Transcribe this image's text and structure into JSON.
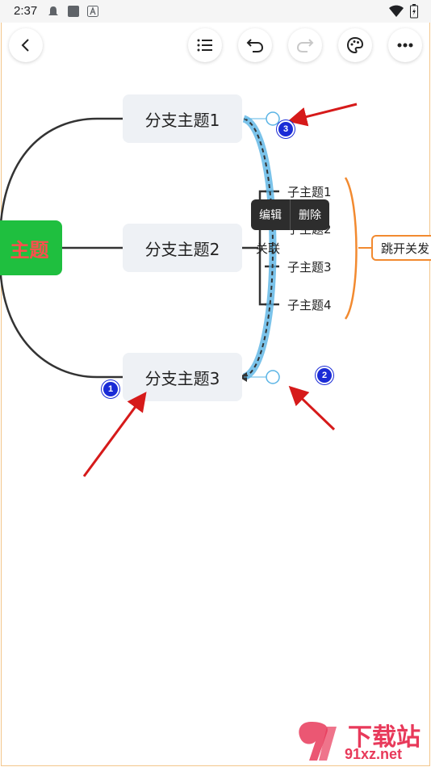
{
  "status_bar": {
    "time": "2:37"
  },
  "toolbar": {
    "back_icon": "chevron-left-icon",
    "outline_icon": "list-icon",
    "undo_icon": "undo-icon",
    "redo_icon": "redo-icon",
    "theme_icon": "palette-icon",
    "more_icon": "more-horizontal-icon"
  },
  "mindmap": {
    "central_topic": "主题",
    "central_color": "#1fbf3f",
    "central_text_color": "#ff4d4d",
    "branches": [
      "分支主题1",
      "分支主题2",
      "分支主题3"
    ],
    "subtopics": [
      "子主题1",
      "子主题2",
      "子主题3",
      "子主题4"
    ],
    "relation_label": "关联",
    "summary_topic": "跳开关发",
    "relation_color": "#5ab4e5",
    "summary_color": "#f28a30"
  },
  "context_menu": {
    "edit": "编辑",
    "delete": "删除"
  },
  "annotations": {
    "marker_1": "1",
    "marker_2": "2",
    "marker_3": "3",
    "arrow_color": "#d61a1a"
  },
  "watermark": {
    "brand": "下载站",
    "domain": "91xz.net"
  }
}
